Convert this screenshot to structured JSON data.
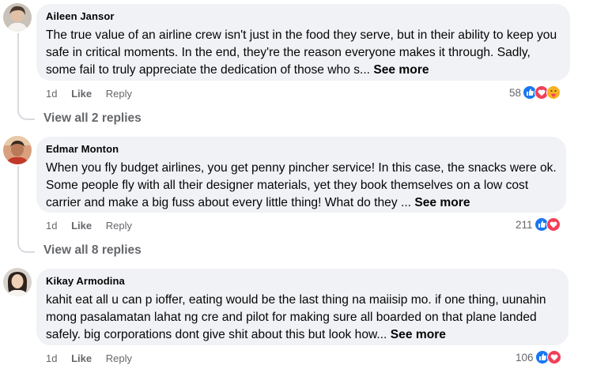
{
  "comments": [
    {
      "author": "Aileen Jansor",
      "text": "The true value of an airline crew isn't just in the food they serve, but in their ability to keep you safe in critical moments. In the end, they're the reason everyone makes it through. Sadly, some fail to truly appreciate the dedication of those who s...",
      "see_more": "See more",
      "time": "1d",
      "like": "Like",
      "reply": "Reply",
      "reaction_count": "58",
      "reactions": [
        "like-icon",
        "love-icon",
        "care-icon"
      ],
      "view_replies": "View all 2 replies"
    },
    {
      "author": "Edmar Monton",
      "text": "When you fly budget airlines, you get penny pincher service! In this case, the snacks were ok. Some people fly with all their designer materials, yet they book themselves on a low cost carrier and make a big fuss about every little thing! What do they ...",
      "see_more": "See more",
      "time": "1d",
      "like": "Like",
      "reply": "Reply",
      "reaction_count": "211",
      "reactions": [
        "like-icon",
        "love-icon"
      ],
      "view_replies": "View all 8 replies"
    },
    {
      "author": "Kikay Armodina",
      "text": "kahit eat all u can p ioffer, eating would be the last thing na maiisip mo. if one thing, uunahin mong pasalamatan lahat ng cre and pilot for making sure all boarded on that plane landed safely. big corporations dont give shit about this but look how...",
      "see_more": "See more",
      "time": "1d",
      "like": "Like",
      "reply": "Reply",
      "reaction_count": "106",
      "reactions": [
        "like-icon",
        "love-icon"
      ]
    }
  ],
  "colors": {
    "bubble": "#f0f2f5",
    "secondary_text": "#65676b",
    "like_blue": "#1877f2",
    "love_red": "#f33e58",
    "care_yellow": "#f7b125"
  }
}
